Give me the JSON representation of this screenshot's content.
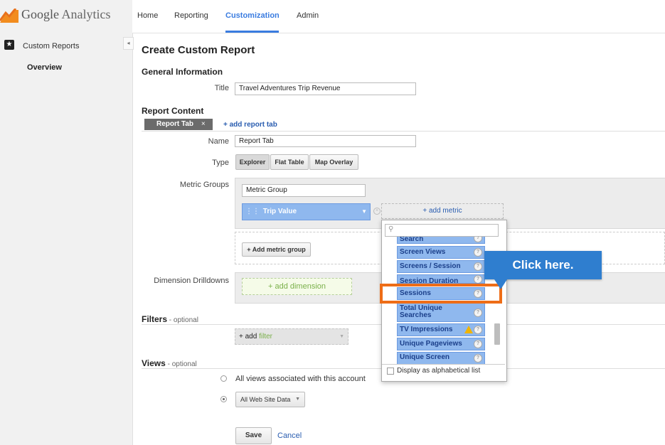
{
  "app": {
    "logo_google": "Google",
    "logo_analytics": "Analytics"
  },
  "nav": {
    "tabs": [
      "Home",
      "Reporting",
      "Customization",
      "Admin"
    ],
    "active": "Customization"
  },
  "sidebar": {
    "item": "Custom Reports",
    "subitem": "Overview",
    "collapse": "◂"
  },
  "page": {
    "title": "Create Custom Report"
  },
  "general": {
    "heading": "General Information",
    "title_label": "Title",
    "title_value": "Travel Adventures Trip Revenue"
  },
  "report_content": {
    "heading": "Report Content",
    "tab_name": "Report Tab",
    "tab_close": "×",
    "add_tab": "+ add report tab",
    "name_label": "Name",
    "name_value": "Report Tab",
    "type_label": "Type",
    "types": [
      "Explorer",
      "Flat Table",
      "Map Overlay"
    ],
    "metric_groups_label": "Metric Groups",
    "metric_group_name": "Metric Group",
    "metric_chip": "Trip Value",
    "add_metric": "+ add metric",
    "add_metric_group": "+ Add metric group",
    "dimension_label": "Dimension Drilldowns",
    "add_dimension": "+ add dimension"
  },
  "metric_dropdown": {
    "items": [
      "Search",
      "Screen Views",
      "Screens / Session",
      "Session Duration",
      "Sessions",
      "Total Unique Searches",
      "TV Impressions",
      "Unique Pageviews",
      "Unique Screen"
    ],
    "alphabetical_label": "Display as alphabetical list",
    "help": "?"
  },
  "callout": {
    "text": "Click here."
  },
  "filters": {
    "heading": "Filters",
    "optional": " - optional",
    "add": "+ add",
    "add_word": "filter"
  },
  "views": {
    "heading": "Views",
    "optional": " - optional",
    "option_all": "All views associated with this account",
    "selected_view": "All Web Site Data"
  },
  "actions": {
    "save": "Save",
    "cancel": "Cancel"
  },
  "colors": {
    "accent": "#3a7ce0",
    "chip": "#8fb8ee",
    "callout": "#2f7ecf",
    "highlight": "#ee6d17",
    "add_link": "#7ab04a"
  }
}
